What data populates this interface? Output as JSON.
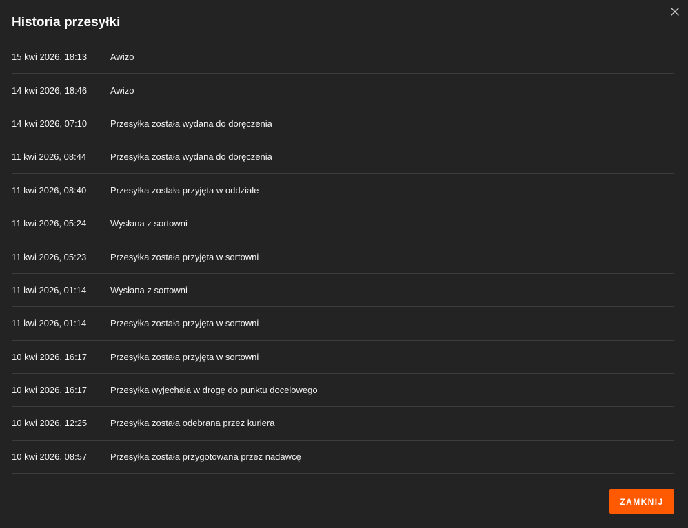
{
  "modal": {
    "title": "Historia przesyłki",
    "close_icon": "close-icon",
    "close_button_label": "ZAMKNIJ",
    "accent_color": "#ff5a00",
    "background_color": "#232323"
  },
  "history": [
    {
      "date": "15 kwi 2026, 18:13",
      "status": "Awizo"
    },
    {
      "date": "14 kwi 2026, 18:46",
      "status": "Awizo"
    },
    {
      "date": "14 kwi 2026, 07:10",
      "status": "Przesyłka została wydana do doręczenia"
    },
    {
      "date": "11 kwi 2026, 08:44",
      "status": "Przesyłka została wydana do doręczenia"
    },
    {
      "date": "11 kwi 2026, 08:40",
      "status": "Przesyłka została przyjęta w oddziale"
    },
    {
      "date": "11 kwi 2026, 05:24",
      "status": "Wysłana z sortowni"
    },
    {
      "date": "11 kwi 2026, 05:23",
      "status": "Przesyłka została przyjęta w sortowni"
    },
    {
      "date": "11 kwi 2026, 01:14",
      "status": "Wysłana z sortowni"
    },
    {
      "date": "11 kwi 2026, 01:14",
      "status": "Przesyłka została przyjęta w sortowni"
    },
    {
      "date": "10 kwi 2026, 16:17",
      "status": "Przesyłka została przyjęta w sortowni"
    },
    {
      "date": "10 kwi 2026, 16:17",
      "status": "Przesyłka wyjechała w drogę do punktu docelowego"
    },
    {
      "date": "10 kwi 2026, 12:25",
      "status": "Przesyłka została odebrana przez kuriera"
    },
    {
      "date": "10 kwi 2026, 08:57",
      "status": "Przesyłka została przygotowana przez nadawcę"
    }
  ]
}
